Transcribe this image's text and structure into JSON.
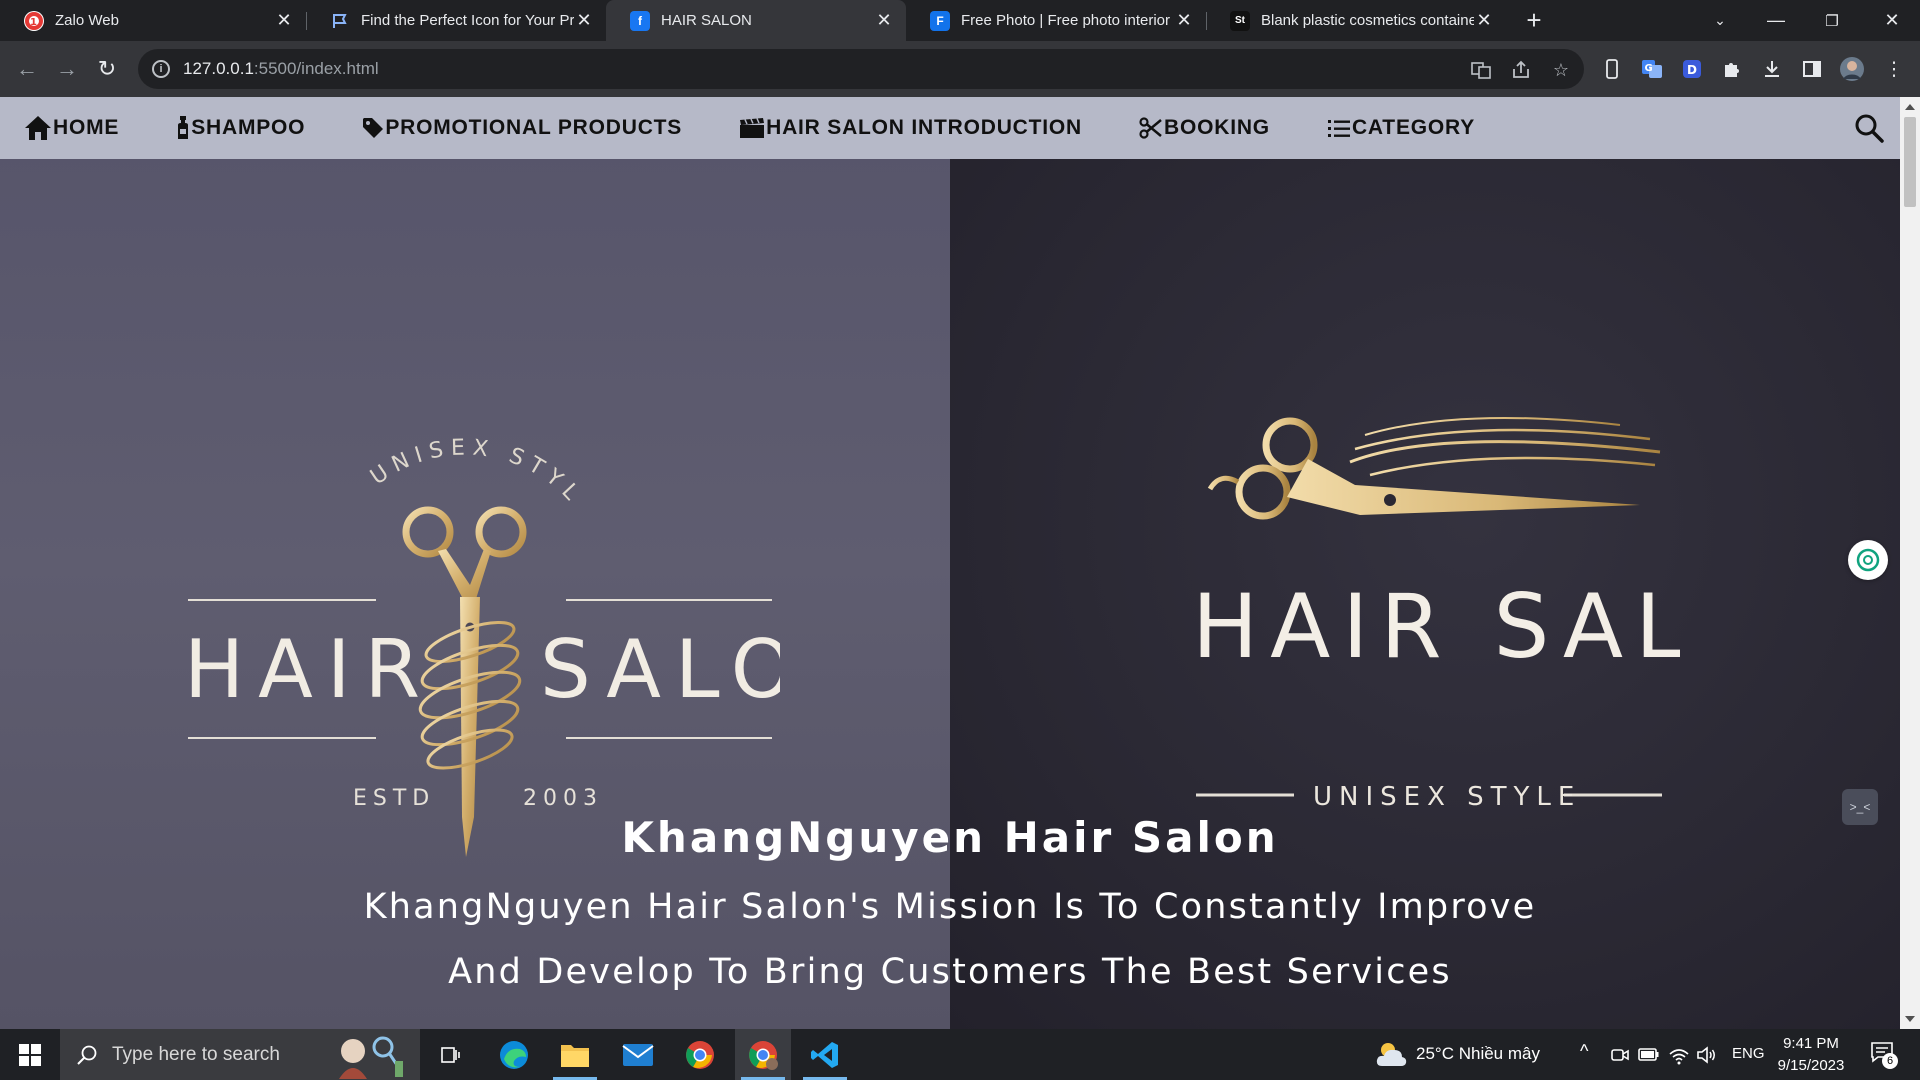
{
  "browser": {
    "tabs": [
      {
        "title": "Zalo Web",
        "icon": "zalo-icon",
        "active": false
      },
      {
        "title": "Find the Perfect Icon for Your Pro",
        "icon": "flag-icon",
        "active": false
      },
      {
        "title": "HAIR SALON",
        "icon": "facebook-icon",
        "active": true
      },
      {
        "title": "Free Photo | Free photo interior c",
        "icon": "freepik-icon",
        "active": false
      },
      {
        "title": "Blank plastic cosmetics container",
        "icon": "stock-icon",
        "active": false
      }
    ],
    "url_host": "127.0.0.1",
    "url_rest": ":5500/index.html"
  },
  "nav": {
    "items": [
      {
        "label": "HOME",
        "icon": "home-icon"
      },
      {
        "label": "SHAMPOO",
        "icon": "bottle-icon"
      },
      {
        "label": "PROMOTIONAL PRODUCTS",
        "icon": "tag-icon"
      },
      {
        "label": "HAIR SALON INTRODUCTION",
        "icon": "clapperboard-icon"
      },
      {
        "label": "BOOKING",
        "icon": "scissors-icon"
      },
      {
        "label": "CATEGORY",
        "icon": "list-icon"
      }
    ],
    "search_icon": "search-icon"
  },
  "logo_left": {
    "arc_text": "UNISEX STYLE",
    "left_word": "HAIR",
    "right_word": "SALON",
    "estd": "ESTD",
    "year": "2003"
  },
  "logo_right": {
    "title": "HAIR SALON",
    "subtitle": "UNISEX STYLE"
  },
  "hero": {
    "title": "KhangNguyen Hair Salon",
    "mission_line1": "KhangNguyen Hair Salon's Mission Is To Constantly Improve",
    "mission_line2": "And Develop To Bring Customers The Best Services"
  },
  "taskbar": {
    "search_placeholder": "Type here to search",
    "weather": "25°C  Nhiều mây",
    "language": "ENG",
    "time": "9:41 PM",
    "date": "9/15/2023",
    "notifications": "6"
  },
  "colors": {
    "gold": "#d8b979",
    "nav_bg": "#b6b9c8",
    "hero_left": "#5a5869",
    "hero_right": "#2a2833"
  }
}
